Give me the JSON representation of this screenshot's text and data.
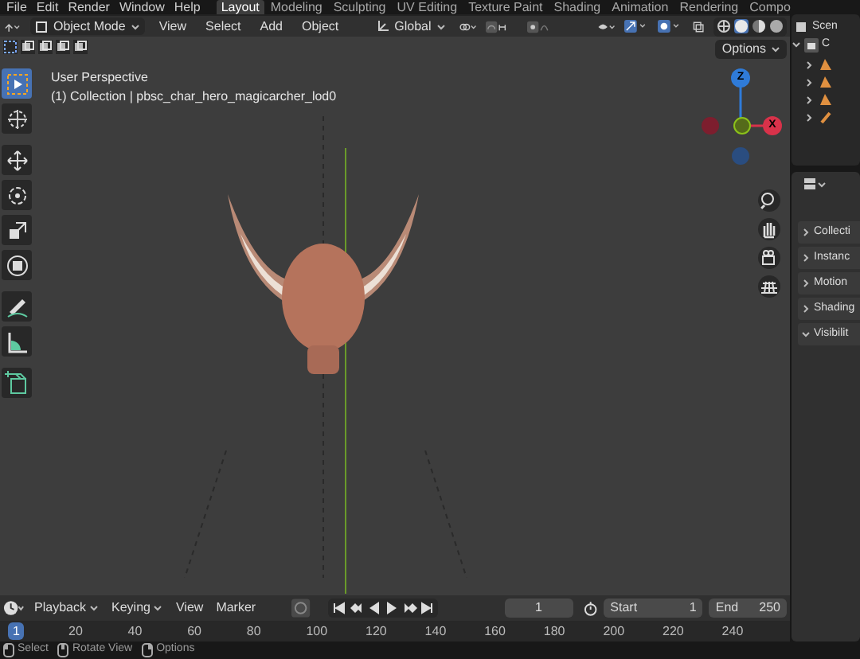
{
  "menu_bar": {
    "menus": [
      "File",
      "Edit",
      "Render",
      "Window",
      "Help"
    ],
    "workspaces": [
      {
        "label": "Layout",
        "selected": true
      },
      {
        "label": "Modeling",
        "selected": false
      },
      {
        "label": "Sculpting",
        "selected": false
      },
      {
        "label": "UV Editing",
        "selected": false
      },
      {
        "label": "Texture Paint",
        "selected": false
      },
      {
        "label": "Shading",
        "selected": false
      },
      {
        "label": "Animation",
        "selected": false
      },
      {
        "label": "Rendering",
        "selected": false
      },
      {
        "label": "Compo",
        "selected": false
      }
    ]
  },
  "header": {
    "mode": "Object Mode",
    "menus": [
      "View",
      "Select",
      "Add",
      "Object"
    ],
    "orientation": "Global"
  },
  "viewport": {
    "options": "Options",
    "title": "User Perspective",
    "subtitle": "(1) Collection | pbsc_char_hero_magicarcher_lod0",
    "tools": [
      {
        "kind": "select",
        "selected": true
      },
      {
        "kind": "cursor",
        "selected": false
      },
      {
        "kind": "move",
        "selected": false
      },
      {
        "kind": "rotate",
        "selected": false
      },
      {
        "kind": "scale",
        "selected": false
      },
      {
        "kind": "transform",
        "selected": false
      },
      {
        "kind": "annotate",
        "selected": false
      },
      {
        "kind": "measure",
        "selected": false
      },
      {
        "kind": "add",
        "selected": false
      }
    ],
    "axes": [
      {
        "label": "Z",
        "color": "#2f7bd8"
      },
      {
        "label": "X",
        "color": "#d8324a"
      }
    ]
  },
  "outliner": {
    "scene": "Scen",
    "collection": "C",
    "objects": [
      {
        "kind": "mesh",
        "expanded": false
      },
      {
        "kind": "mesh",
        "expanded": false
      },
      {
        "kind": "mesh",
        "expanded": false
      },
      {
        "kind": "armature",
        "expanded": false
      }
    ]
  },
  "properties": {
    "panels": [
      {
        "label": "Collecti",
        "expanded": false
      },
      {
        "label": "Instanc",
        "expanded": false
      },
      {
        "label": "Motion",
        "expanded": false
      },
      {
        "label": "Shading",
        "expanded": false
      },
      {
        "label": "Visibilit",
        "expanded": true
      }
    ]
  },
  "timeline": {
    "menus": [
      "Playback",
      "Keying",
      "View",
      "Marker"
    ],
    "current_frame": "1",
    "start_label": "Start",
    "start": "1",
    "end_label": "End",
    "end": "250",
    "ticks": [
      {
        "label": "1",
        "selected": true
      },
      {
        "label": "20",
        "selected": false
      },
      {
        "label": "40",
        "selected": false
      },
      {
        "label": "60",
        "selected": false
      },
      {
        "label": "80",
        "selected": false
      },
      {
        "label": "100",
        "selected": false
      },
      {
        "label": "120",
        "selected": false
      },
      {
        "label": "140",
        "selected": false
      },
      {
        "label": "160",
        "selected": false
      },
      {
        "label": "180",
        "selected": false
      },
      {
        "label": "200",
        "selected": false
      },
      {
        "label": "220",
        "selected": false
      },
      {
        "label": "240",
        "selected": false
      }
    ]
  },
  "status_bar": [
    "Select",
    "Rotate View",
    "Options"
  ]
}
